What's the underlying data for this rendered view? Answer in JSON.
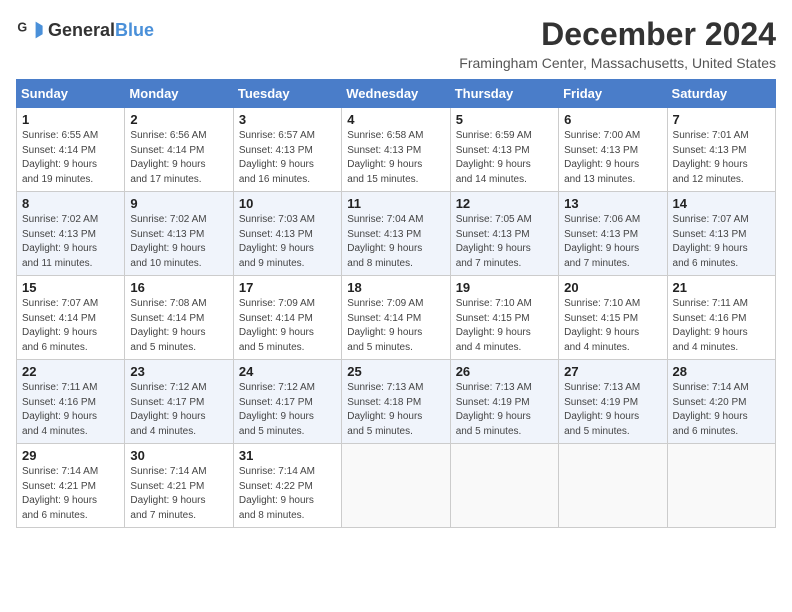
{
  "header": {
    "logo_general": "General",
    "logo_blue": "Blue",
    "title": "December 2024",
    "location": "Framingham Center, Massachusetts, United States"
  },
  "days_of_week": [
    "Sunday",
    "Monday",
    "Tuesday",
    "Wednesday",
    "Thursday",
    "Friday",
    "Saturday"
  ],
  "weeks": [
    [
      {
        "day": "1",
        "info": "Sunrise: 6:55 AM\nSunset: 4:14 PM\nDaylight: 9 hours\nand 19 minutes."
      },
      {
        "day": "2",
        "info": "Sunrise: 6:56 AM\nSunset: 4:14 PM\nDaylight: 9 hours\nand 17 minutes."
      },
      {
        "day": "3",
        "info": "Sunrise: 6:57 AM\nSunset: 4:13 PM\nDaylight: 9 hours\nand 16 minutes."
      },
      {
        "day": "4",
        "info": "Sunrise: 6:58 AM\nSunset: 4:13 PM\nDaylight: 9 hours\nand 15 minutes."
      },
      {
        "day": "5",
        "info": "Sunrise: 6:59 AM\nSunset: 4:13 PM\nDaylight: 9 hours\nand 14 minutes."
      },
      {
        "day": "6",
        "info": "Sunrise: 7:00 AM\nSunset: 4:13 PM\nDaylight: 9 hours\nand 13 minutes."
      },
      {
        "day": "7",
        "info": "Sunrise: 7:01 AM\nSunset: 4:13 PM\nDaylight: 9 hours\nand 12 minutes."
      }
    ],
    [
      {
        "day": "8",
        "info": "Sunrise: 7:02 AM\nSunset: 4:13 PM\nDaylight: 9 hours\nand 11 minutes."
      },
      {
        "day": "9",
        "info": "Sunrise: 7:02 AM\nSunset: 4:13 PM\nDaylight: 9 hours\nand 10 minutes."
      },
      {
        "day": "10",
        "info": "Sunrise: 7:03 AM\nSunset: 4:13 PM\nDaylight: 9 hours\nand 9 minutes."
      },
      {
        "day": "11",
        "info": "Sunrise: 7:04 AM\nSunset: 4:13 PM\nDaylight: 9 hours\nand 8 minutes."
      },
      {
        "day": "12",
        "info": "Sunrise: 7:05 AM\nSunset: 4:13 PM\nDaylight: 9 hours\nand 7 minutes."
      },
      {
        "day": "13",
        "info": "Sunrise: 7:06 AM\nSunset: 4:13 PM\nDaylight: 9 hours\nand 7 minutes."
      },
      {
        "day": "14",
        "info": "Sunrise: 7:07 AM\nSunset: 4:13 PM\nDaylight: 9 hours\nand 6 minutes."
      }
    ],
    [
      {
        "day": "15",
        "info": "Sunrise: 7:07 AM\nSunset: 4:14 PM\nDaylight: 9 hours\nand 6 minutes."
      },
      {
        "day": "16",
        "info": "Sunrise: 7:08 AM\nSunset: 4:14 PM\nDaylight: 9 hours\nand 5 minutes."
      },
      {
        "day": "17",
        "info": "Sunrise: 7:09 AM\nSunset: 4:14 PM\nDaylight: 9 hours\nand 5 minutes."
      },
      {
        "day": "18",
        "info": "Sunrise: 7:09 AM\nSunset: 4:14 PM\nDaylight: 9 hours\nand 5 minutes."
      },
      {
        "day": "19",
        "info": "Sunrise: 7:10 AM\nSunset: 4:15 PM\nDaylight: 9 hours\nand 4 minutes."
      },
      {
        "day": "20",
        "info": "Sunrise: 7:10 AM\nSunset: 4:15 PM\nDaylight: 9 hours\nand 4 minutes."
      },
      {
        "day": "21",
        "info": "Sunrise: 7:11 AM\nSunset: 4:16 PM\nDaylight: 9 hours\nand 4 minutes."
      }
    ],
    [
      {
        "day": "22",
        "info": "Sunrise: 7:11 AM\nSunset: 4:16 PM\nDaylight: 9 hours\nand 4 minutes."
      },
      {
        "day": "23",
        "info": "Sunrise: 7:12 AM\nSunset: 4:17 PM\nDaylight: 9 hours\nand 4 minutes."
      },
      {
        "day": "24",
        "info": "Sunrise: 7:12 AM\nSunset: 4:17 PM\nDaylight: 9 hours\nand 5 minutes."
      },
      {
        "day": "25",
        "info": "Sunrise: 7:13 AM\nSunset: 4:18 PM\nDaylight: 9 hours\nand 5 minutes."
      },
      {
        "day": "26",
        "info": "Sunrise: 7:13 AM\nSunset: 4:19 PM\nDaylight: 9 hours\nand 5 minutes."
      },
      {
        "day": "27",
        "info": "Sunrise: 7:13 AM\nSunset: 4:19 PM\nDaylight: 9 hours\nand 5 minutes."
      },
      {
        "day": "28",
        "info": "Sunrise: 7:14 AM\nSunset: 4:20 PM\nDaylight: 9 hours\nand 6 minutes."
      }
    ],
    [
      {
        "day": "29",
        "info": "Sunrise: 7:14 AM\nSunset: 4:21 PM\nDaylight: 9 hours\nand 6 minutes."
      },
      {
        "day": "30",
        "info": "Sunrise: 7:14 AM\nSunset: 4:21 PM\nDaylight: 9 hours\nand 7 minutes."
      },
      {
        "day": "31",
        "info": "Sunrise: 7:14 AM\nSunset: 4:22 PM\nDaylight: 9 hours\nand 8 minutes."
      },
      {
        "day": "",
        "info": ""
      },
      {
        "day": "",
        "info": ""
      },
      {
        "day": "",
        "info": ""
      },
      {
        "day": "",
        "info": ""
      }
    ]
  ]
}
